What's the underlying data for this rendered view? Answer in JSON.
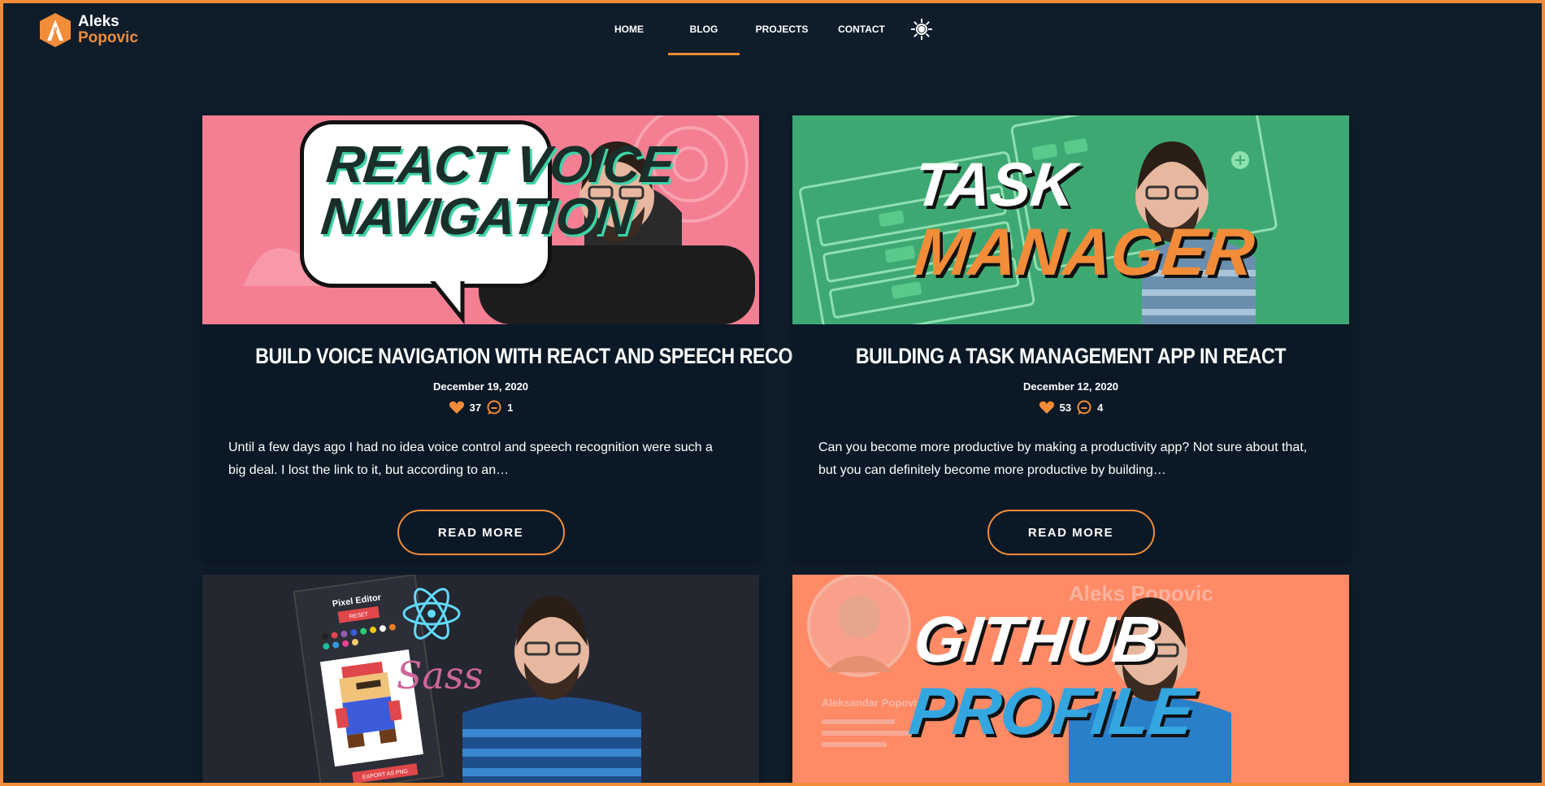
{
  "brand": {
    "first_name": "Aleks",
    "last_name": "Popovic",
    "accent_color": "#f28c38",
    "background_color": "#0f1d2b"
  },
  "nav": {
    "items": [
      {
        "label": "HOME",
        "active": false
      },
      {
        "label": "BLOG",
        "active": true
      },
      {
        "label": "PROJECTS",
        "active": false
      },
      {
        "label": "CONTACT",
        "active": false
      }
    ],
    "theme_toggle_icon": "sun-icon"
  },
  "posts": [
    {
      "banner_lines": [
        "REACT VOICE",
        "NAVIGATION"
      ],
      "title": "Build Voice Navigation with React and Speech Recognition",
      "date": "December 19, 2020",
      "likes": "37",
      "comments": "1",
      "excerpt": "Until a few days ago I had no idea voice control and speech recognition were such a big deal. I lost the link to it, but according to an…",
      "read_more": "READ MORE"
    },
    {
      "banner_lines": [
        "TASK",
        "MANAGER"
      ],
      "title": "Building a Task Management App in React",
      "date": "December 12, 2020",
      "likes": "53",
      "comments": "4",
      "excerpt": "Can you become more productive by making a productivity app? Not sure about that, but you can definitely become more productive by building…",
      "read_more": "READ MORE"
    },
    {
      "banner_lines": [
        "Pixel Editor",
        "RESET",
        "EXPORT AS PNG",
        "Sass"
      ]
    },
    {
      "banner_lines": [
        "GITHUB",
        "PROFILE",
        "Aleks Popovic",
        "Aleksandar Popović"
      ]
    }
  ]
}
